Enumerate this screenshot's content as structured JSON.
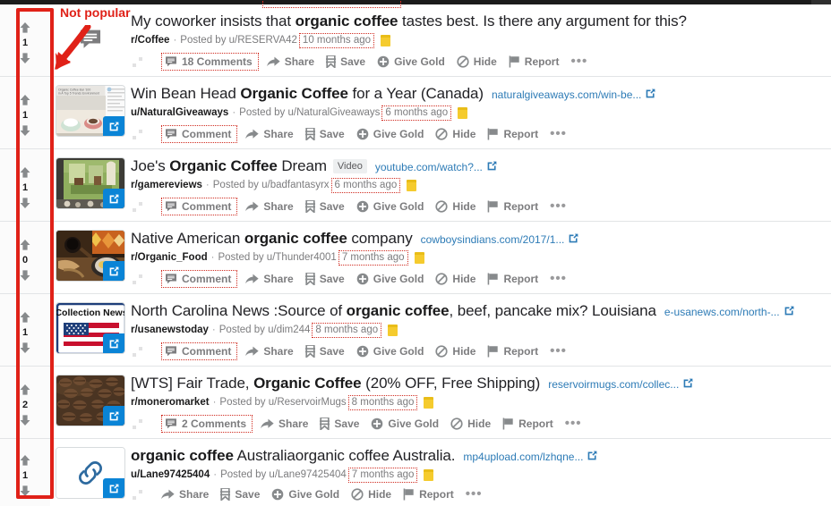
{
  "annotation": {
    "label": "Not popular",
    "color": "#e02118",
    "arrow_name": "red-down-left-arrow",
    "highlight_region": "vote-score-column"
  },
  "actions_common": {
    "share": "Share",
    "save": "Save",
    "give_gold": "Give Gold",
    "hide": "Hide",
    "report": "Report",
    "more": "•••"
  },
  "colors": {
    "accent_link": "#2d7bb6",
    "annotation_red": "#e02118",
    "award_gold": "#f5cb2e",
    "vote_arrow": "#878a8c",
    "title_text": "#222226",
    "meta_text": "#7c7c7e",
    "thumb_badge": "#0a84d6"
  },
  "posts": [
    {
      "score": "1",
      "thumb": "comment-bubble-icon",
      "title_pre": "My coworker insists that ",
      "title_bold": "organic coffee",
      "title_post": " tastes best. Is there any argument for this?",
      "flair": "",
      "domain": "",
      "subreddit": "r/Coffee",
      "posted_by": "Posted by u/RESERVA42",
      "time": "10 months ago",
      "award": true,
      "comments": "18 Comments"
    },
    {
      "score": "1",
      "thumb": "coffee-cups-article-thumbnail",
      "title_pre": "Win Bean Head ",
      "title_bold": "Organic Coffee",
      "title_post": " for a Year (Canada)",
      "flair": "",
      "domain": "naturalgiveaways.com/win-be...",
      "subreddit": "u/NaturalGiveaways",
      "posted_by": "Posted by u/NaturalGiveaways",
      "time": "6 months ago",
      "award": true,
      "comments": "Comment"
    },
    {
      "score": "1",
      "thumb": "game-scene-video-thumbnail",
      "title_pre": "Joe's ",
      "title_bold": "Organic Coffee",
      "title_post": " Dream",
      "flair": "Video",
      "domain": "youtube.com/watch?...",
      "subreddit": "r/gamereviews",
      "posted_by": "Posted by u/badfantasyrx",
      "time": "6 months ago",
      "award": true,
      "comments": "Comment"
    },
    {
      "score": "0",
      "thumb": "native-american-coffee-thumbnail",
      "title_pre": "Native American ",
      "title_bold": "organic coffee",
      "title_post": " company",
      "flair": "",
      "domain": "cowboysindians.com/2017/1...",
      "subreddit": "r/Organic_Food",
      "posted_by": "Posted by u/Thunder4001",
      "time": "7 months ago",
      "award": true,
      "comments": "Comment"
    },
    {
      "score": "1",
      "thumb": "collection-news-usa-flag-thumbnail",
      "title_pre": "North Carolina News :Source of ",
      "title_bold": "organic coffee",
      "title_post": ", beef, pancake mix? Louisiana",
      "flair": "",
      "domain": "e-usanews.com/north-...",
      "subreddit": "r/usanewstoday",
      "posted_by": "Posted by u/dim244",
      "time": "8 months ago",
      "award": true,
      "comments": "Comment"
    },
    {
      "score": "2",
      "thumb": "coffee-beans-thumbnail",
      "title_pre": "[WTS] Fair Trade, ",
      "title_bold": "Organic Coffee",
      "title_post": " (20% OFF, Free Shipping)",
      "flair": "",
      "domain": "reservoirmugs.com/collec...",
      "subreddit": "r/moneromarket",
      "posted_by": "Posted by u/ReservoirMugs",
      "time": "8 months ago",
      "award": true,
      "comments": "2 Comments"
    },
    {
      "score": "1",
      "thumb": "generic-link-thumbnail",
      "title_pre": "",
      "title_bold": "organic coffee",
      "title_post": " Australiaorganic coffee Australia.",
      "flair": "",
      "domain": "mp4upload.com/lzhqne...",
      "subreddit": "u/Lane97425404",
      "posted_by": "Posted by u/Lane97425404",
      "time": "7 months ago",
      "award": true,
      "comments": ""
    }
  ]
}
